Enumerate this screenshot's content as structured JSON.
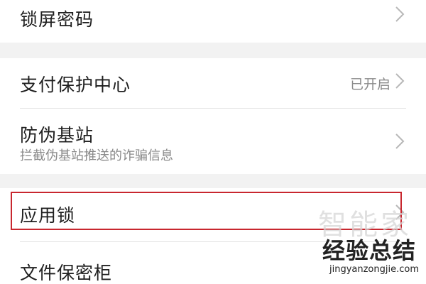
{
  "settings": {
    "items": [
      {
        "title": "锁屏密码",
        "subtitle": "",
        "status": ""
      },
      {
        "title": "支付保护中心",
        "subtitle": "",
        "status": "已开启"
      },
      {
        "title": "防伪基站",
        "subtitle": "拦截伪基站推送的诈骗信息",
        "status": ""
      },
      {
        "title": "应用锁",
        "subtitle": "",
        "status": ""
      },
      {
        "title": "文件保密柜",
        "subtitle": "",
        "status": ""
      }
    ]
  },
  "watermark": {
    "top": "智能家",
    "middle": "经验总结",
    "url": "jingyanzongjie.com"
  },
  "colors": {
    "highlight_border": "#c8272f",
    "section_gap": "#f2f2f2",
    "secondary_text": "#8a8a8a"
  },
  "icons": [
    "chevron-right-icon"
  ]
}
